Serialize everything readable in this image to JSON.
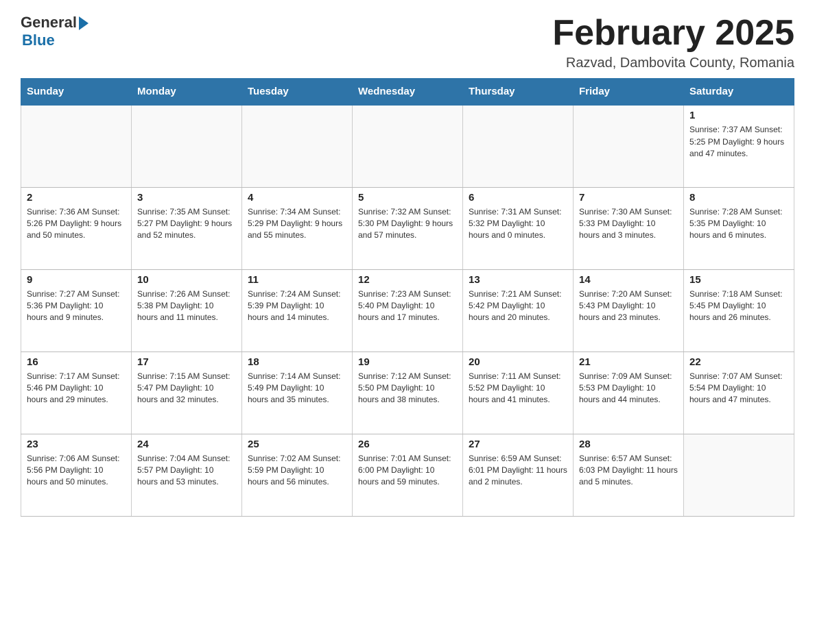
{
  "header": {
    "logo_general": "General",
    "logo_blue": "Blue",
    "month_title": "February 2025",
    "location": "Razvad, Dambovita County, Romania"
  },
  "weekdays": [
    "Sunday",
    "Monday",
    "Tuesday",
    "Wednesday",
    "Thursday",
    "Friday",
    "Saturday"
  ],
  "weeks": [
    [
      {
        "day": "",
        "info": ""
      },
      {
        "day": "",
        "info": ""
      },
      {
        "day": "",
        "info": ""
      },
      {
        "day": "",
        "info": ""
      },
      {
        "day": "",
        "info": ""
      },
      {
        "day": "",
        "info": ""
      },
      {
        "day": "1",
        "info": "Sunrise: 7:37 AM\nSunset: 5:25 PM\nDaylight: 9 hours and 47 minutes."
      }
    ],
    [
      {
        "day": "2",
        "info": "Sunrise: 7:36 AM\nSunset: 5:26 PM\nDaylight: 9 hours and 50 minutes."
      },
      {
        "day": "3",
        "info": "Sunrise: 7:35 AM\nSunset: 5:27 PM\nDaylight: 9 hours and 52 minutes."
      },
      {
        "day": "4",
        "info": "Sunrise: 7:34 AM\nSunset: 5:29 PM\nDaylight: 9 hours and 55 minutes."
      },
      {
        "day": "5",
        "info": "Sunrise: 7:32 AM\nSunset: 5:30 PM\nDaylight: 9 hours and 57 minutes."
      },
      {
        "day": "6",
        "info": "Sunrise: 7:31 AM\nSunset: 5:32 PM\nDaylight: 10 hours and 0 minutes."
      },
      {
        "day": "7",
        "info": "Sunrise: 7:30 AM\nSunset: 5:33 PM\nDaylight: 10 hours and 3 minutes."
      },
      {
        "day": "8",
        "info": "Sunrise: 7:28 AM\nSunset: 5:35 PM\nDaylight: 10 hours and 6 minutes."
      }
    ],
    [
      {
        "day": "9",
        "info": "Sunrise: 7:27 AM\nSunset: 5:36 PM\nDaylight: 10 hours and 9 minutes."
      },
      {
        "day": "10",
        "info": "Sunrise: 7:26 AM\nSunset: 5:38 PM\nDaylight: 10 hours and 11 minutes."
      },
      {
        "day": "11",
        "info": "Sunrise: 7:24 AM\nSunset: 5:39 PM\nDaylight: 10 hours and 14 minutes."
      },
      {
        "day": "12",
        "info": "Sunrise: 7:23 AM\nSunset: 5:40 PM\nDaylight: 10 hours and 17 minutes."
      },
      {
        "day": "13",
        "info": "Sunrise: 7:21 AM\nSunset: 5:42 PM\nDaylight: 10 hours and 20 minutes."
      },
      {
        "day": "14",
        "info": "Sunrise: 7:20 AM\nSunset: 5:43 PM\nDaylight: 10 hours and 23 minutes."
      },
      {
        "day": "15",
        "info": "Sunrise: 7:18 AM\nSunset: 5:45 PM\nDaylight: 10 hours and 26 minutes."
      }
    ],
    [
      {
        "day": "16",
        "info": "Sunrise: 7:17 AM\nSunset: 5:46 PM\nDaylight: 10 hours and 29 minutes."
      },
      {
        "day": "17",
        "info": "Sunrise: 7:15 AM\nSunset: 5:47 PM\nDaylight: 10 hours and 32 minutes."
      },
      {
        "day": "18",
        "info": "Sunrise: 7:14 AM\nSunset: 5:49 PM\nDaylight: 10 hours and 35 minutes."
      },
      {
        "day": "19",
        "info": "Sunrise: 7:12 AM\nSunset: 5:50 PM\nDaylight: 10 hours and 38 minutes."
      },
      {
        "day": "20",
        "info": "Sunrise: 7:11 AM\nSunset: 5:52 PM\nDaylight: 10 hours and 41 minutes."
      },
      {
        "day": "21",
        "info": "Sunrise: 7:09 AM\nSunset: 5:53 PM\nDaylight: 10 hours and 44 minutes."
      },
      {
        "day": "22",
        "info": "Sunrise: 7:07 AM\nSunset: 5:54 PM\nDaylight: 10 hours and 47 minutes."
      }
    ],
    [
      {
        "day": "23",
        "info": "Sunrise: 7:06 AM\nSunset: 5:56 PM\nDaylight: 10 hours and 50 minutes."
      },
      {
        "day": "24",
        "info": "Sunrise: 7:04 AM\nSunset: 5:57 PM\nDaylight: 10 hours and 53 minutes."
      },
      {
        "day": "25",
        "info": "Sunrise: 7:02 AM\nSunset: 5:59 PM\nDaylight: 10 hours and 56 minutes."
      },
      {
        "day": "26",
        "info": "Sunrise: 7:01 AM\nSunset: 6:00 PM\nDaylight: 10 hours and 59 minutes."
      },
      {
        "day": "27",
        "info": "Sunrise: 6:59 AM\nSunset: 6:01 PM\nDaylight: 11 hours and 2 minutes."
      },
      {
        "day": "28",
        "info": "Sunrise: 6:57 AM\nSunset: 6:03 PM\nDaylight: 11 hours and 5 minutes."
      },
      {
        "day": "",
        "info": ""
      }
    ]
  ]
}
